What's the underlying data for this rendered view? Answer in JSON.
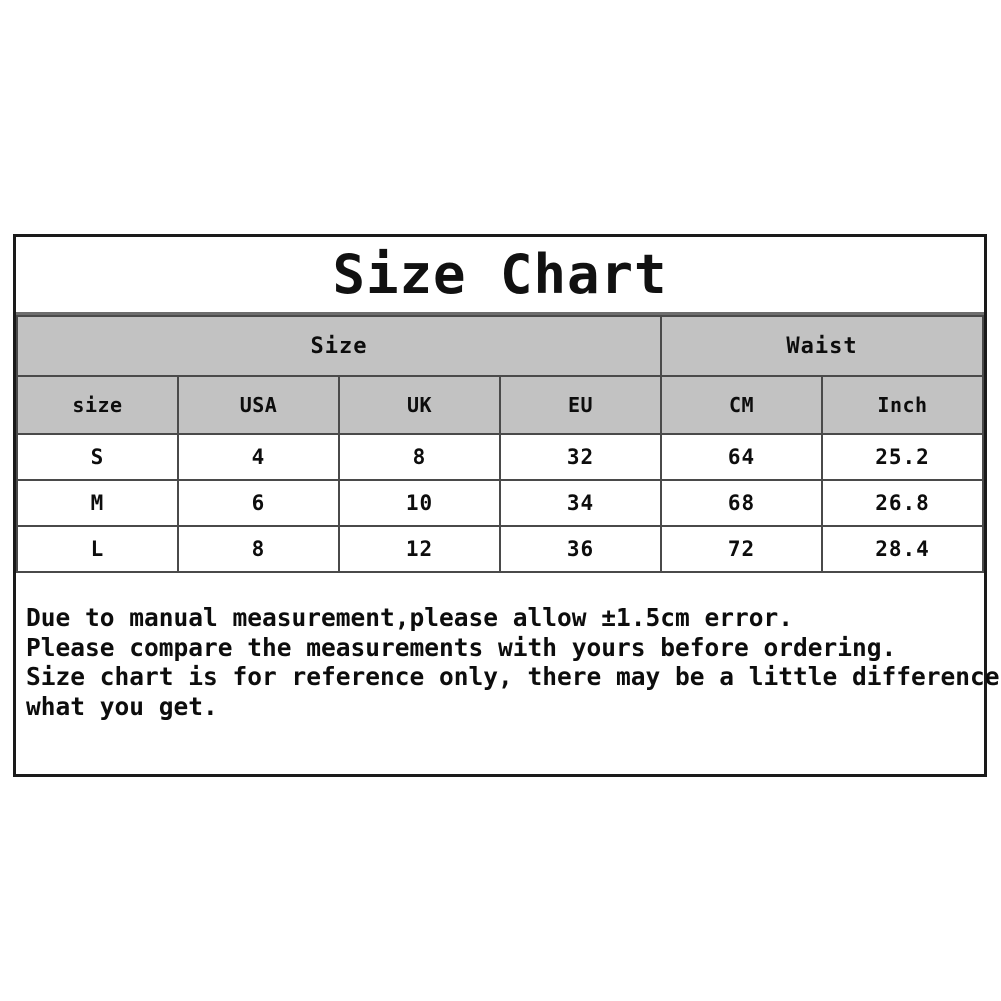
{
  "card": {
    "title": "Size Chart"
  },
  "table": {
    "group_headers": [
      {
        "label": "Size",
        "span": 4
      },
      {
        "label": "Waist",
        "span": 2
      }
    ],
    "columns": [
      "size",
      "USA",
      "UK",
      "EU",
      "CM",
      "Inch"
    ],
    "rows": [
      {
        "size": "S",
        "usa": "4",
        "uk": "8",
        "eu": "32",
        "cm": "64",
        "inch": "25.2"
      },
      {
        "size": "M",
        "usa": "6",
        "uk": "10",
        "eu": "34",
        "cm": "68",
        "inch": "26.8"
      },
      {
        "size": "L",
        "usa": "8",
        "uk": "12",
        "eu": "36",
        "cm": "72",
        "inch": "28.4"
      }
    ]
  },
  "notes": [
    "Due to manual measurement,please allow ±1.5cm error.",
    "Please compare the measurements with yours before ordering.",
    "Size chart is for reference only, there may be a little difference with",
    "what you get."
  ],
  "colors": {
    "header_fill": "#c2c2c2",
    "border": "#4a4a4a",
    "outer_border": "#1a1a1a",
    "text": "#0d0d0d",
    "background": "#ffffff"
  },
  "chart_data": {
    "type": "table",
    "title": "Size Chart",
    "columns": [
      "size",
      "USA",
      "UK",
      "EU",
      "CM",
      "Inch"
    ],
    "column_groups": [
      "Size",
      "Size",
      "Size",
      "Size",
      "Waist",
      "Waist"
    ],
    "rows": [
      [
        "S",
        "4",
        "8",
        "32",
        "64",
        "25.2"
      ],
      [
        "M",
        "6",
        "10",
        "34",
        "68",
        "26.8"
      ],
      [
        "L",
        "8",
        "12",
        "36",
        "72",
        "28.4"
      ]
    ],
    "units": {
      "CM": "centimeters",
      "Inch": "inches"
    },
    "measurement": "Waist",
    "tolerance": "±1.5cm"
  }
}
